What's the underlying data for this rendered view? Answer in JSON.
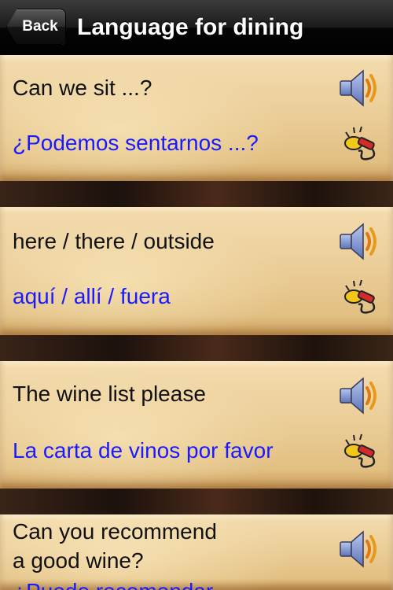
{
  "navbar": {
    "back_label": "Back",
    "title": "Language for dining"
  },
  "phrases": [
    {
      "english": "Can we sit ...?",
      "spanish": "¿Podemos sentarnos ...?"
    },
    {
      "english": "here / there / outside",
      "spanish": "aquí / allí / fuera"
    },
    {
      "english": "The wine list please",
      "spanish": "La carta de vinos por favor"
    },
    {
      "english_line1": "Can you recommend",
      "english_line2": "a good wine?",
      "spanish": "¿Puede recomendar"
    }
  ],
  "icons": {
    "play": "speaker-icon",
    "record": "microphone-icon"
  },
  "colors": {
    "spanish_text": "#1a1aff",
    "english_text": "#111111"
  }
}
